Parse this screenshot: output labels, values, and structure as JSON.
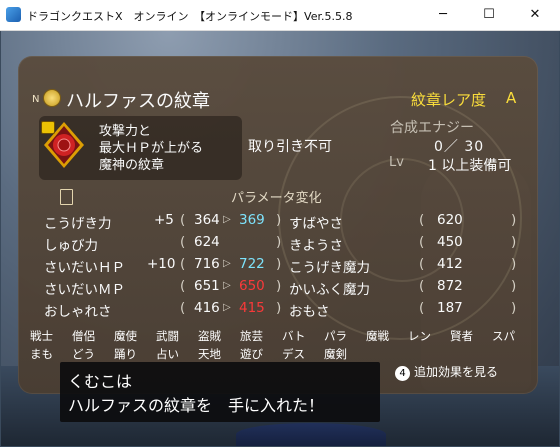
{
  "window": {
    "title": "ドラゴンクエストX　オンライン　【オンラインモード】Ver.5.5.8",
    "minimize": "─",
    "maximize": "☐",
    "close": "✕"
  },
  "item": {
    "prefix": "N",
    "name": "ハルファスの紋章",
    "rarity_label": "紋章レア度",
    "rarity_value": "A",
    "description": [
      "攻撃力と",
      "最大ＨＰが上がる",
      "魔神の紋章"
    ],
    "trade": "取り引き不可",
    "energy_label": "合成エナジー",
    "energy_value": "0／ 30",
    "level_label": "Lv",
    "level_value": "1 以上装備可"
  },
  "params": {
    "title": "パラメータ変化",
    "left": [
      {
        "label": "こうげき力",
        "bonus": "+5",
        "open": "(",
        "before": "364",
        "arrow": "▷",
        "after": "369",
        "after_color": "#7fe6ff",
        "close": ")"
      },
      {
        "label": "しゅび力",
        "bonus": "",
        "open": "(",
        "before": "624",
        "arrow": "",
        "after": "",
        "after_color": "#ffffff",
        "close": ")"
      },
      {
        "label": "さいだいＨＰ",
        "bonus": "+10",
        "open": "(",
        "before": "716",
        "arrow": "▷",
        "after": "722",
        "after_color": "#7fe6ff",
        "close": ")"
      },
      {
        "label": "さいだいＭＰ",
        "bonus": "",
        "open": "(",
        "before": "651",
        "arrow": "▷",
        "after": "650",
        "after_color": "#ff3838",
        "close": ")"
      },
      {
        "label": "おしゃれさ",
        "bonus": "",
        "open": "(",
        "before": "416",
        "arrow": "▷",
        "after": "415",
        "after_color": "#ff3838",
        "close": ")"
      }
    ],
    "right": [
      {
        "label": "すばやさ",
        "open": "(",
        "value": "620",
        "close": ")"
      },
      {
        "label": "きようさ",
        "open": "(",
        "value": "450",
        "close": ")"
      },
      {
        "label": "こうげき魔力",
        "open": "(",
        "value": "412",
        "close": ")"
      },
      {
        "label": "かいふく魔力",
        "open": "(",
        "value": "872",
        "close": ")"
      },
      {
        "label": "おもさ",
        "open": "(",
        "value": "187",
        "close": ")"
      }
    ]
  },
  "jobs": {
    "row1": [
      "戦士",
      "僧侶",
      "魔使",
      "武闘",
      "盗賊",
      "旅芸",
      "バト",
      "パラ",
      "魔戦",
      "レン",
      "賢者",
      "スパ"
    ],
    "row2": [
      "まも",
      "どう",
      "踊り",
      "占い",
      "天地",
      "遊び",
      "デス",
      "魔剣"
    ]
  },
  "extra_button": {
    "key": "4",
    "label": "追加効果を見る"
  },
  "message": [
    "くむこは",
    "ハルファスの紋章を　手に入れた！"
  ],
  "colors": {
    "panel": "#55473a",
    "rarity": "#ffe13a",
    "increase": "#7fe6ff",
    "decrease": "#ff3838"
  },
  "icons": [
    "app-icon",
    "coin-icon",
    "emblem-icon",
    "lock-icon",
    "parameter-book-icon"
  ]
}
